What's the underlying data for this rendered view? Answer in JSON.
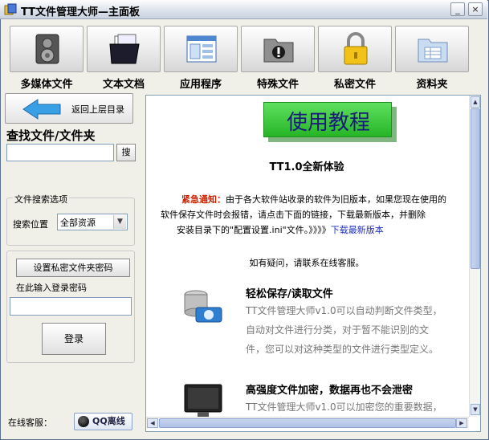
{
  "window": {
    "title": "TT文件管理大师—主面板",
    "minimize": "_",
    "close": "×"
  },
  "toolbar": {
    "items": [
      {
        "label": "多媒体文件",
        "icon": "speaker-icon"
      },
      {
        "label": "文本文档",
        "icon": "folder-documents-icon"
      },
      {
        "label": "应用程序",
        "icon": "application-window-icon"
      },
      {
        "label": "特殊文件",
        "icon": "special-folder-icon"
      },
      {
        "label": "私密文件",
        "icon": "padlock-icon"
      },
      {
        "label": "资料夹",
        "icon": "data-folder-icon"
      }
    ]
  },
  "sidebar": {
    "back_label": "返回上层目录",
    "find_title": "查找文件/文件夹",
    "find_value": "",
    "find_button": "搜",
    "search_options_legend": "文件搜索选项",
    "location_label": "搜索位置",
    "location_value": "全部资源",
    "set_password_button": "设置私密文件夹密码",
    "password_label": "在此输入登录密码",
    "login_button": "登录",
    "customer_service_label": "在线客服：",
    "qq_button": "QQ离线"
  },
  "content": {
    "banner": "使用教程",
    "subtitle": "TT1.0全新体验",
    "notice_prefix": "紧急通知：",
    "notice_line1": "由于各大软件站收录的软件为旧版本，如果您现在使用的",
    "notice_line2": "软件保存文件时会报错，请点击下面的链接，下载最新版本，并删除",
    "notice_line3": "安装目录下的\"配置设置.ini\"文件。》》》》",
    "notice_link": "下载最新版本",
    "ask": "如有疑问，请联系在线客服。",
    "features": [
      {
        "title": "轻松保存/读取文件",
        "lines": [
          "TT文件管理大师v1.0可以自动判断文件类型，",
          "自动对文件进行分类，对于暂不能识别的文",
          "件，您可以对这种类型的文件进行类型定义。"
        ]
      },
      {
        "title": "高强度文件加密，数据再也不会泄密",
        "lines": [
          "TT文件管理大师v1.0可以加密您的重要数据，"
        ]
      }
    ]
  },
  "colors": {
    "urgent": "#cc2200",
    "link": "#2030c0",
    "banner_bg": "#26b526",
    "banner_text": "#1a1a7a"
  }
}
